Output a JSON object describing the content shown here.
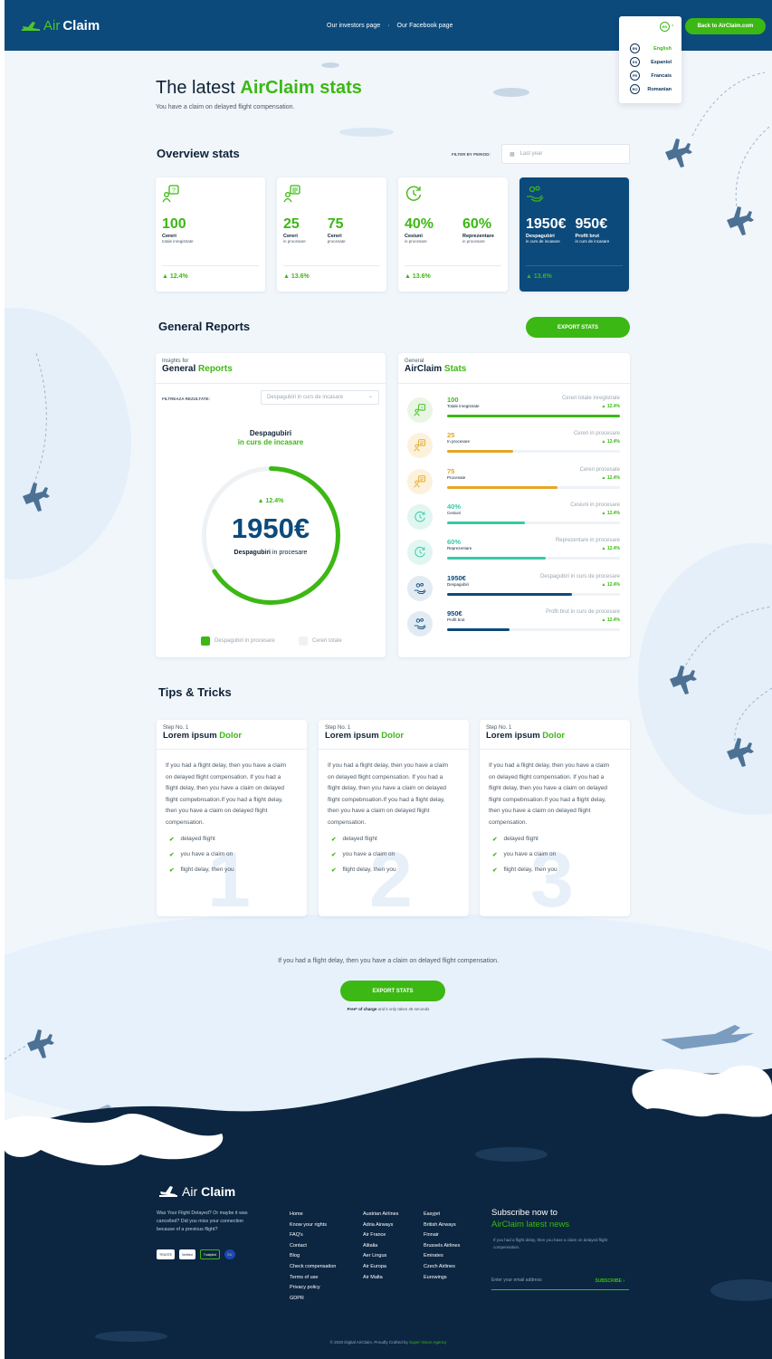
{
  "header": {
    "logo_air": "Air",
    "logo_claim": "Claim",
    "nav": [
      "Our investors page",
      "Our Facebook page"
    ],
    "back_button": "Back to AirClaim.com",
    "language_current": "EN",
    "languages": [
      {
        "code": "EN",
        "label": "English"
      },
      {
        "code": "ES",
        "label": "Espaniol"
      },
      {
        "code": "FR",
        "label": "Francais"
      },
      {
        "code": "RO",
        "label": "Romanian"
      }
    ]
  },
  "hero": {
    "title_prefix": "The latest ",
    "title_highlight": "AirClaim stats",
    "subtitle": "You have a claim on delayed flight compensation."
  },
  "overview": {
    "title": "Overview stats",
    "filter_label": "FILTER BY PERIOD:",
    "filter_value": "Last year",
    "cards": [
      {
        "icon": "question-chat-icon",
        "items": [
          {
            "value": "100",
            "label": "Cereri",
            "sub": "totale inregistrate"
          }
        ],
        "trend": "12.4%"
      },
      {
        "icon": "document-chat-icon",
        "items": [
          {
            "value": "25",
            "label": "Cereri",
            "sub": "in procesare"
          },
          {
            "value": "75",
            "label": "Cereri",
            "sub": "procesate"
          }
        ],
        "trend": "13.6%"
      },
      {
        "icon": "clock-refresh-icon",
        "items": [
          {
            "value": "40%",
            "label": "Cesiuni",
            "sub": "in procesare"
          },
          {
            "value": "60%",
            "label": "Reprezentare",
            "sub": "in procesare"
          }
        ],
        "trend": "13.6%"
      },
      {
        "icon": "hand-money-icon",
        "items": [
          {
            "value": "1950€",
            "label": "Despagubiri",
            "sub": "in curs de incasare"
          },
          {
            "value": "950€",
            "label": "Profit brut",
            "sub": "in curs de incasare"
          }
        ],
        "trend": "13.6%"
      }
    ]
  },
  "reports": {
    "title": "General Reports",
    "export_button": "EXPORT STATS",
    "insights": {
      "small": "Insights for",
      "title_dark": "General",
      "title_green": "Reports",
      "filter_label": "FILTREAZA REZULTATE:",
      "select_value": "Despagubiri in curs de incasare",
      "gauge_title": "Despagubiri",
      "gauge_sub": "in curs de incasare",
      "gauge_trend": "12.4%",
      "gauge_value": "1950€",
      "gauge_label_bold": "Despagubiri",
      "gauge_label_rest": " in procesare",
      "gauge_fraction": 0.66,
      "legend": [
        "Despagubiri in procesare",
        "Cereri totale"
      ]
    },
    "general": {
      "small": "General",
      "title_dark": "AirClaim",
      "title_green": "Stats",
      "rows": [
        {
          "icon": "question-chat-icon",
          "value": "100",
          "label": "Totale inregistrate",
          "right": "Cereri totale inregistrate",
          "trend": "12.4%",
          "fill": 1.0,
          "color": "#3cb814",
          "bg": "#e9f6e4"
        },
        {
          "icon": "document-chat-icon",
          "value": "25",
          "label": "In procesare",
          "right": "Cereri in procesare",
          "trend": "12.4%",
          "fill": 0.38,
          "color": "#e5a526",
          "bg": "#fcf2dc"
        },
        {
          "icon": "document-chat-icon",
          "value": "75",
          "label": "Procesate",
          "right": "Cereri procesate",
          "trend": "12.4%",
          "fill": 0.64,
          "color": "#e5a526",
          "bg": "#fcf2dc"
        },
        {
          "icon": "clock-refresh-icon",
          "value": "40%",
          "label": "Cesiuni",
          "right": "Cesiuni in procesare",
          "trend": "12.4%",
          "fill": 0.45,
          "color": "#36c9a6",
          "bg": "#e0f6f0"
        },
        {
          "icon": "clock-refresh-icon",
          "value": "60%",
          "label": "Reprezentare",
          "right": "Reprezentare in procesare",
          "trend": "12.4%",
          "fill": 0.57,
          "color": "#36c9a6",
          "bg": "#e0f6f0"
        },
        {
          "icon": "hand-money-icon",
          "value": "1950€",
          "label": "Despagubiri",
          "right": "Despagubiri in curs de procesare",
          "trend": "12.4%",
          "fill": 0.72,
          "color": "#0c4a7c",
          "bg": "#e2ebf3"
        },
        {
          "icon": "hand-money-icon",
          "value": "950€",
          "label": "Profit brut",
          "right": "Profit brut in curs de procesare",
          "trend": "12.4%",
          "fill": 0.36,
          "color": "#0c4a7c",
          "bg": "#e2ebf3"
        }
      ]
    }
  },
  "tips": {
    "title": "Tips & Tricks",
    "cards": [
      {
        "step": "Step No. 1",
        "title_dark": "Lorem ipsum ",
        "title_green": "Dolor",
        "number": "1"
      },
      {
        "step": "Step No. 1",
        "title_dark": "Lorem ipsum ",
        "title_green": "Dolor",
        "number": "2"
      },
      {
        "step": "Step No. 1",
        "title_dark": "Lorem ipsum ",
        "title_green": "Dolor",
        "number": "3"
      }
    ],
    "body": "If you had a flight delay, then you have a claim on delayed flight compensation. If you had a flight delay, then you have a claim on delayed flight compebnsation.If you had a flight delay, then you have a claim on delayed flight compensation.",
    "checks": [
      "delayed flight",
      "you have a claim on",
      "flight delay, then you"
    ]
  },
  "cta": {
    "text": "If you had a flight delay, then you have a claim on delayed flight compensation.",
    "button": "EXPORT STATS",
    "free_bold": "Free* of charge",
    "free_rest": " and it only takes 45 seconds"
  },
  "footer": {
    "logo_air": "Air",
    "logo_claim": "Claim",
    "text": "Was Your Flight Delayed? Or maybe it was cancelled? Did you miss your connection because of a previous flight?",
    "badges": [
      "TRUSTE",
      "Verified",
      "Trustpilot",
      "EU"
    ],
    "col1": [
      "Home",
      "Know your rights",
      "FAQ's",
      "Contact",
      "Blog",
      "Check compensation",
      "Terms of use",
      "Privacy policy",
      "GDPR"
    ],
    "col2": [
      "Austrian Airlines",
      "Adria Airways",
      "Air France",
      "Alitalia",
      "Aer Lingus",
      "Air Europa",
      "Air Malta"
    ],
    "col3": [
      "Easyjet",
      "British Airways",
      "Finnair",
      "Brussels Airlines",
      "Emirates",
      "Czech Airlines",
      "Eurowings"
    ],
    "subscribe_line1": "Subscribe now to",
    "subscribe_line2": "AirClaim latest news",
    "subscribe_text": "If you had a flight delay, then you have a claim on delayed flight compensation.",
    "email_placeholder": "Enter your email address",
    "subscribe_button": "SUBSCRIBE ›",
    "copyright": "© 2020 Digital AirClaim. Proudly Crafted by ",
    "agency": "Super Vision Agency"
  },
  "colors": {
    "primary": "#0c4a7c",
    "accent": "#3cb814",
    "footer": "#0c2641"
  }
}
